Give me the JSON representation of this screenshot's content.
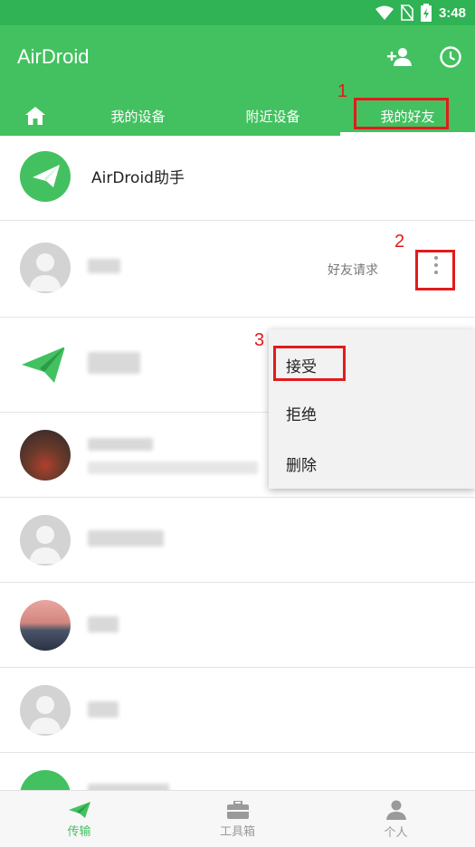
{
  "status_bar": {
    "time": "3:48",
    "icons": [
      "wifi-icon",
      "no-sim-icon",
      "battery-icon"
    ]
  },
  "app_bar": {
    "title": "AirDroid",
    "actions": [
      "add-friend-icon",
      "history-clock-icon"
    ],
    "tabs": [
      {
        "icon": "home-icon"
      },
      {
        "label": "我的设备"
      },
      {
        "label": "附近设备"
      },
      {
        "label": "我的好友",
        "selected": true
      }
    ]
  },
  "friends": [
    {
      "name": "AirDroid助手",
      "avatar": "airdroid-logo"
    },
    {
      "status": "好友请求",
      "avatar": "default-avatar"
    },
    {
      "avatar": "airdroid-plane"
    },
    {
      "avatar": "photo-person"
    },
    {
      "avatar": "default-avatar"
    },
    {
      "avatar": "photo-mountain"
    },
    {
      "avatar": "default-avatar"
    }
  ],
  "context_menu": {
    "items": [
      "接受",
      "拒绝",
      "删除"
    ]
  },
  "annotations": [
    "1",
    "2",
    "3"
  ],
  "bottom_nav": [
    {
      "label": "传输",
      "icon": "send-plane-icon",
      "active": true
    },
    {
      "label": "工具箱",
      "icon": "toolbox-icon"
    },
    {
      "label": "个人",
      "icon": "person-icon"
    }
  ],
  "colors": {
    "primary": "#43c160",
    "status_bar": "#2fb355",
    "annotation": "#e21b1b",
    "nav_active": "#43c160",
    "nav_inactive": "#9a9a9a"
  }
}
